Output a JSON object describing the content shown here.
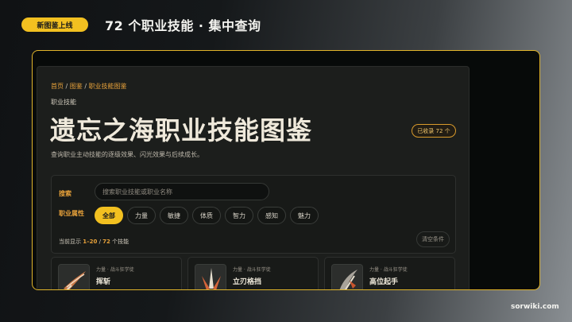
{
  "banner": {
    "badge": "新图鉴上线",
    "headline": "72 个职业技能 · 集中查询"
  },
  "breadcrumb": {
    "home": "首页",
    "sep1": " / ",
    "section": "图鉴",
    "sep2": " / ",
    "current": "职业技能图鉴"
  },
  "page": {
    "eyebrow": "职业技能",
    "title": "遗忘之海职业技能图鉴",
    "count_badge": "已收录 72 个",
    "subtitle": "查询职业主动技能的逐级效果、闪光效果与后续成长。"
  },
  "filters": {
    "search_label": "搜索",
    "search_placeholder": "搜索职业技能或职业名称",
    "search_value": "",
    "attr_label": "职业属性",
    "attributes": [
      "全部",
      "力量",
      "敏捷",
      "体质",
      "智力",
      "感知",
      "魅力"
    ],
    "active_attribute": "全部",
    "results_prefix": "当前显示 ",
    "results_range": "1–20",
    "results_mid": " / ",
    "results_total": "72",
    "results_suffix": " 个技能",
    "clear_label": "清空条件"
  },
  "cards": [
    {
      "meta": "力量 · 战斗狂学徒",
      "name": "挥斩",
      "icon": "slash-skill-icon"
    },
    {
      "meta": "力量 · 战斗狂学徒",
      "name": "立刃格挡",
      "icon": "blade-guard-skill-icon"
    },
    {
      "meta": "力量 · 战斗狂学徒",
      "name": "高位起手",
      "icon": "high-stance-skill-icon"
    }
  ],
  "footer": {
    "site": "sorwiki.com"
  },
  "colors": {
    "accent": "#f2c020",
    "accent_orange": "#e8a23a",
    "frame_border": "#e0b42a"
  }
}
